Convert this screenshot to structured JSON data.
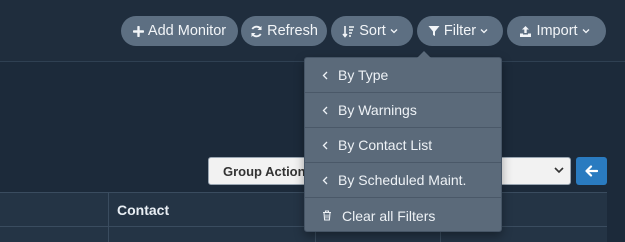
{
  "toolbar": {
    "add_monitor": "Add Monitor",
    "refresh": "Refresh",
    "sort": "Sort",
    "filter": "Filter",
    "import": "Import"
  },
  "group_actions": {
    "label": "Group Actions",
    "go_icon": "arrow-left-icon"
  },
  "table": {
    "columns": [
      "Contact"
    ]
  },
  "filter_menu": {
    "items": [
      {
        "label": "By Type",
        "icon": "chevron-left-icon"
      },
      {
        "label": "By Warnings",
        "icon": "chevron-left-icon"
      },
      {
        "label": "By Contact List",
        "icon": "chevron-left-icon"
      },
      {
        "label": "By Scheduled Maint.",
        "icon": "chevron-left-icon"
      },
      {
        "label": "Clear all Filters",
        "icon": "trash-icon"
      }
    ]
  },
  "colors": {
    "background": "#1c2a3a",
    "button": "#5d6f82",
    "dropdown": "#5b6a7a",
    "go_button": "#2a7bc0"
  }
}
